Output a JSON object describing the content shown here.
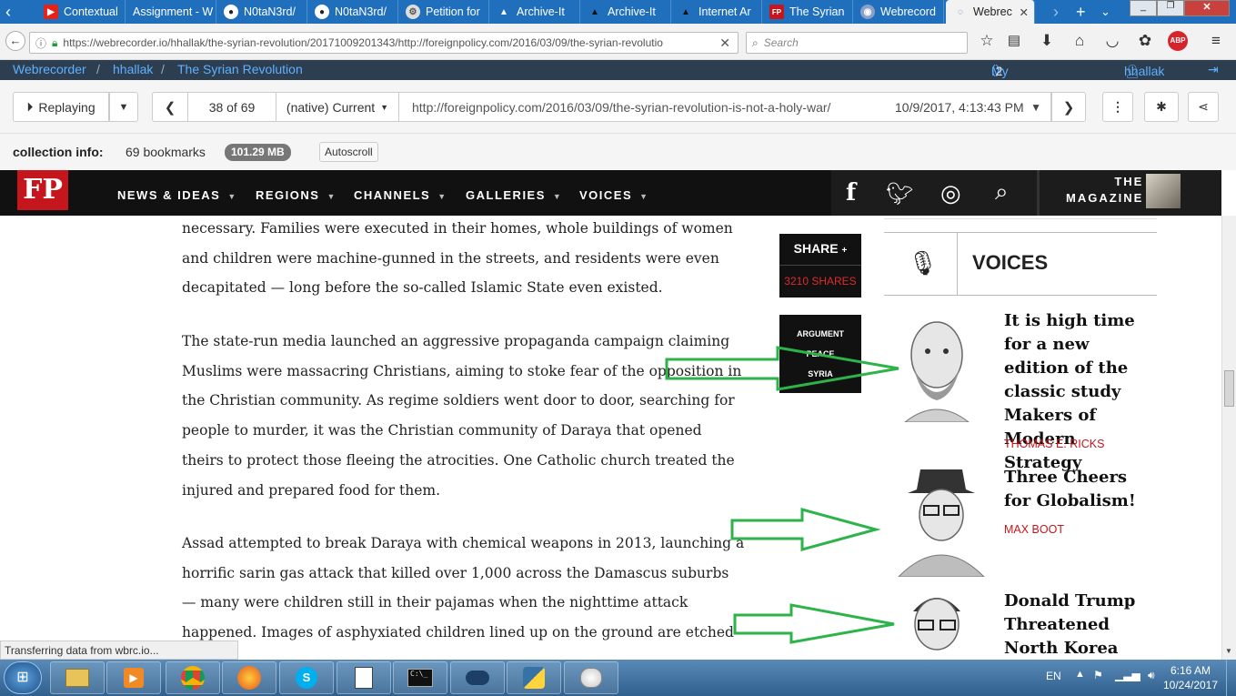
{
  "browser": {
    "tabs": [
      {
        "label": "Contextual",
        "icon": "youtube-icon",
        "color": "#e62117"
      },
      {
        "label": "Assignment - W",
        "icon": "doc-icon",
        "color": "#2a6fc4"
      },
      {
        "label": "N0taN3rd/",
        "icon": "github-icon",
        "color": "#222222"
      },
      {
        "label": "N0taN3rd/",
        "icon": "github-icon",
        "color": "#222222"
      },
      {
        "label": "Petition for",
        "icon": "gear-icon",
        "color": "#555555"
      },
      {
        "label": "Archive-It",
        "icon": "archive-icon",
        "color": "#2a6fc4"
      },
      {
        "label": "Archive-It",
        "icon": "archive-icon",
        "color": "#222222"
      },
      {
        "label": "Internet Ar",
        "icon": "archive-icon",
        "color": "#222222"
      },
      {
        "label": "The Syrian",
        "icon": "fp-icon",
        "color": "#c4161c"
      },
      {
        "label": "Webrecord",
        "icon": "globe-icon",
        "color": "#8aa0c8"
      },
      {
        "label": "Webrec",
        "icon": "loading-icon",
        "color": "#2a6fc4"
      }
    ],
    "url": "https://webrecorder.io/hhallak/the-syrian-revolution/20171009201343/http://foreignpolicy.com/2016/03/09/the-syrian-revolutio",
    "search_placeholder": "Search"
  },
  "webrecorder": {
    "brand": "Webrecorder",
    "sep": "/",
    "user": "hhallak",
    "collection": "The Syrian Revolution",
    "my_collections": "My Collections",
    "my_collections_count": "2",
    "account": "hhallak"
  },
  "replay": {
    "mode": "Replaying",
    "page_position": "38 of 69",
    "browser_select": "(native) Current",
    "page_url": "http://foreignpolicy.com/2016/03/09/the-syrian-revolution-is-not-a-holy-war/",
    "timestamp": "10/9/2017, 4:13:43 PM"
  },
  "collection_info": {
    "label": "collection info:",
    "bookmarks": "69 bookmarks",
    "size": "101.29 MB",
    "autoscroll": "Autoscroll"
  },
  "fp": {
    "logo": "FP",
    "menu": [
      "NEWS & IDEAS",
      "REGIONS",
      "CHANNELS",
      "GALLERIES",
      "VOICES"
    ],
    "magazine_line1": "THE",
    "magazine_line2": "MAGAZINE",
    "share_label": "SHARE",
    "share_count": "3210 SHARES",
    "tags": [
      "ARGUMENT",
      "PEACE",
      "SYRIA"
    ],
    "voices_heading": "VOICES"
  },
  "article": {
    "paragraphs": [
      "necessary. Families were executed in their homes, whole buildings of women and children were machine-gunned in the streets, and residents were even decapitated — long before the so-called Islamic State even existed.",
      "The state-run media launched an aggressive propaganda campaign claiming Muslims were massacring Christians, aiming to stoke fear of the opposition in the Christian community. As regime soldiers went door to door, searching for people to murder, it was the Christian community of Daraya that opened theirs to protect those fleeing the atrocities. One Catholic church treated the injured and prepared food for them.",
      "Assad attempted to break Daraya with chemical weapons in 2013, launching a horrific sarin gas attack that killed over 1,000 across the Damascus suburbs — many were children still in their pajamas when the nighttime attack happened. Images of asphyxiated children lined up on the ground are etched"
    ]
  },
  "voices": [
    {
      "title": "It is high time for a new edition of the classic study Makers of Modern Strategy",
      "author": "THOMAS E. RICKS"
    },
    {
      "title": "Three Cheers for Globalism!",
      "author": "MAX BOOT"
    },
    {
      "title": "Donald Trump Threatened North Korea",
      "author": ""
    }
  ],
  "status_text": "Transferring data from wbrc.io...",
  "system": {
    "language": "EN",
    "time": "6:16 AM",
    "date": "10/24/2017"
  },
  "colors": {
    "fp_red": "#c4161c",
    "arrow_green": "#2db34a",
    "webrecorder_blue": "#5fb0ff"
  }
}
